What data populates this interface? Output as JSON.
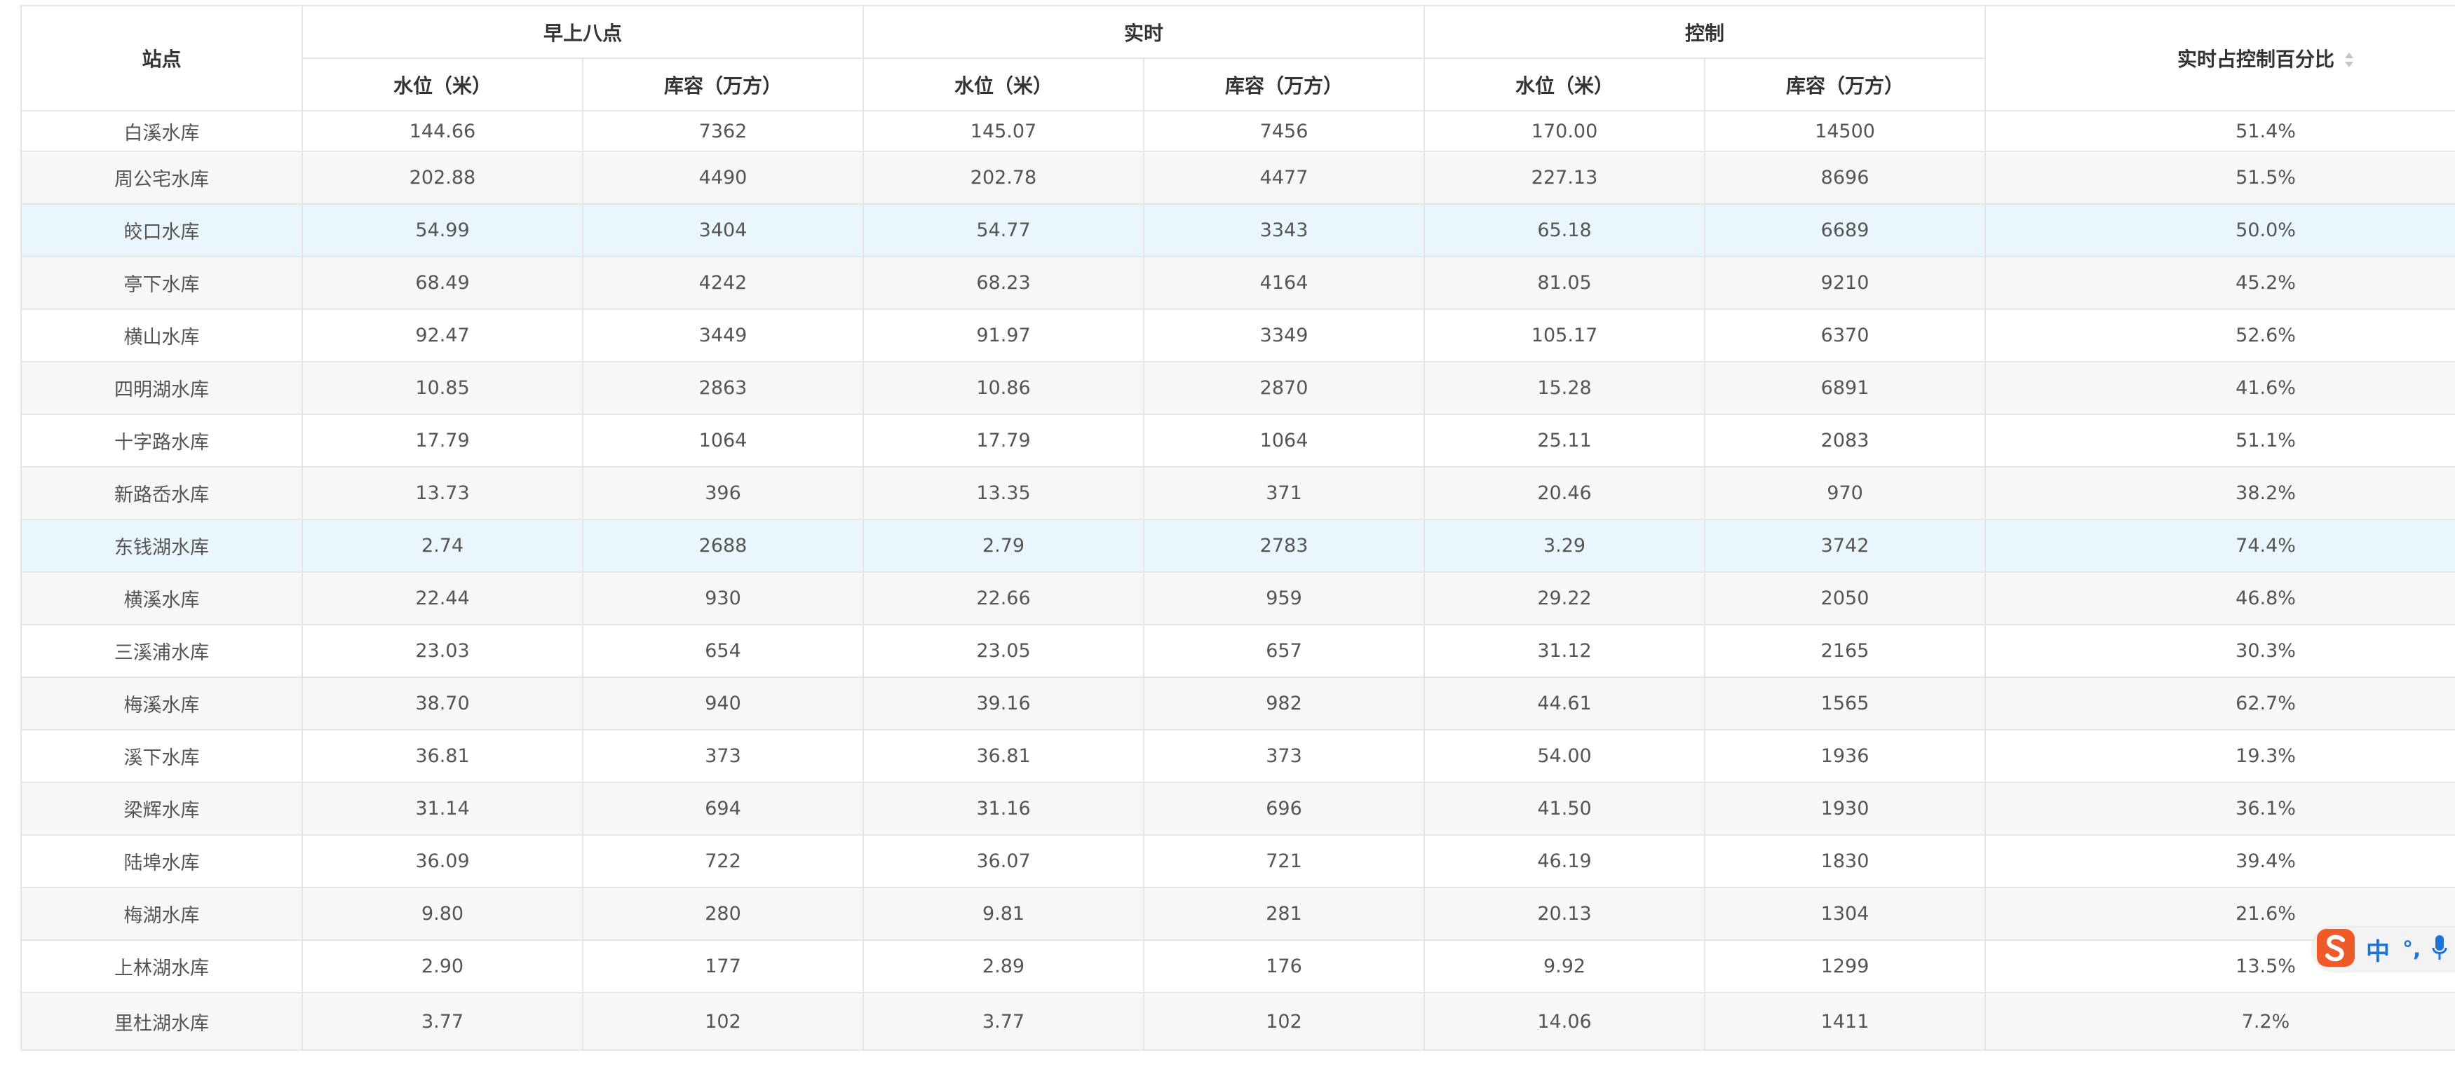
{
  "table": {
    "header": {
      "station": "站点",
      "groups": [
        "早上八点",
        "实时",
        "控制"
      ],
      "sub": {
        "level": "水位（米）",
        "capacity": "库容（万方）"
      },
      "pct": "实时占控制百分比",
      "sort_icon": "sort-caret-icon"
    },
    "rows": [
      {
        "station": "白溪水库",
        "morning_level": "144.66",
        "morning_capacity": "7362",
        "realtime_level": "145.07",
        "realtime_capacity": "7456",
        "control_level": "170.00",
        "control_capacity": "14500",
        "pct": "51.4%"
      },
      {
        "station": "周公宅水库",
        "morning_level": "202.88",
        "morning_capacity": "4490",
        "realtime_level": "202.78",
        "realtime_capacity": "4477",
        "control_level": "227.13",
        "control_capacity": "8696",
        "pct": "51.5%"
      },
      {
        "station": "皎口水库",
        "morning_level": "54.99",
        "morning_capacity": "3404",
        "realtime_level": "54.77",
        "realtime_capacity": "3343",
        "control_level": "65.18",
        "control_capacity": "6689",
        "pct": "50.0%"
      },
      {
        "station": "亭下水库",
        "morning_level": "68.49",
        "morning_capacity": "4242",
        "realtime_level": "68.23",
        "realtime_capacity": "4164",
        "control_level": "81.05",
        "control_capacity": "9210",
        "pct": "45.2%"
      },
      {
        "station": "横山水库",
        "morning_level": "92.47",
        "morning_capacity": "3449",
        "realtime_level": "91.97",
        "realtime_capacity": "3349",
        "control_level": "105.17",
        "control_capacity": "6370",
        "pct": "52.6%"
      },
      {
        "station": "四明湖水库",
        "morning_level": "10.85",
        "morning_capacity": "2863",
        "realtime_level": "10.86",
        "realtime_capacity": "2870",
        "control_level": "15.28",
        "control_capacity": "6891",
        "pct": "41.6%"
      },
      {
        "station": "十字路水库",
        "morning_level": "17.79",
        "morning_capacity": "1064",
        "realtime_level": "17.79",
        "realtime_capacity": "1064",
        "control_level": "25.11",
        "control_capacity": "2083",
        "pct": "51.1%"
      },
      {
        "station": "新路岙水库",
        "morning_level": "13.73",
        "morning_capacity": "396",
        "realtime_level": "13.35",
        "realtime_capacity": "371",
        "control_level": "20.46",
        "control_capacity": "970",
        "pct": "38.2%"
      },
      {
        "station": "东钱湖水库",
        "morning_level": "2.74",
        "morning_capacity": "2688",
        "realtime_level": "2.79",
        "realtime_capacity": "2783",
        "control_level": "3.29",
        "control_capacity": "3742",
        "pct": "74.4%"
      },
      {
        "station": "横溪水库",
        "morning_level": "22.44",
        "morning_capacity": "930",
        "realtime_level": "22.66",
        "realtime_capacity": "959",
        "control_level": "29.22",
        "control_capacity": "2050",
        "pct": "46.8%"
      },
      {
        "station": "三溪浦水库",
        "morning_level": "23.03",
        "morning_capacity": "654",
        "realtime_level": "23.05",
        "realtime_capacity": "657",
        "control_level": "31.12",
        "control_capacity": "2165",
        "pct": "30.3%"
      },
      {
        "station": "梅溪水库",
        "morning_level": "38.70",
        "morning_capacity": "940",
        "realtime_level": "39.16",
        "realtime_capacity": "982",
        "control_level": "44.61",
        "control_capacity": "1565",
        "pct": "62.7%"
      },
      {
        "station": "溪下水库",
        "morning_level": "36.81",
        "morning_capacity": "373",
        "realtime_level": "36.81",
        "realtime_capacity": "373",
        "control_level": "54.00",
        "control_capacity": "1936",
        "pct": "19.3%"
      },
      {
        "station": "梁辉水库",
        "morning_level": "31.14",
        "morning_capacity": "694",
        "realtime_level": "31.16",
        "realtime_capacity": "696",
        "control_level": "41.50",
        "control_capacity": "1930",
        "pct": "36.1%"
      },
      {
        "station": "陆埠水库",
        "morning_level": "36.09",
        "morning_capacity": "722",
        "realtime_level": "36.07",
        "realtime_capacity": "721",
        "control_level": "46.19",
        "control_capacity": "1830",
        "pct": "39.4%"
      },
      {
        "station": "梅湖水库",
        "morning_level": "9.80",
        "morning_capacity": "280",
        "realtime_level": "9.81",
        "realtime_capacity": "281",
        "control_level": "20.13",
        "control_capacity": "1304",
        "pct": "21.6%"
      },
      {
        "station": "上林湖水库",
        "morning_level": "2.90",
        "morning_capacity": "177",
        "realtime_level": "2.89",
        "realtime_capacity": "176",
        "control_level": "9.92",
        "control_capacity": "1299",
        "pct": "13.5%"
      },
      {
        "station": "里杜湖水库",
        "morning_level": "3.77",
        "morning_capacity": "102",
        "realtime_level": "3.77",
        "realtime_capacity": "102",
        "control_level": "14.06",
        "control_capacity": "1411",
        "pct": "7.2%"
      }
    ]
  },
  "ime": {
    "logo_icon": "sogou-s-logo-icon",
    "mode": "中",
    "punct": "°,",
    "mic_icon": "microphone-icon"
  },
  "colors": {
    "header_text": "#333333",
    "cell_text": "#555555",
    "border": "#e6e6e6",
    "stripe": "#f7f7f7",
    "highlight": "#e9f6fd",
    "ime_blue": "#1e73d6",
    "ime_logo": "#f05a28"
  }
}
